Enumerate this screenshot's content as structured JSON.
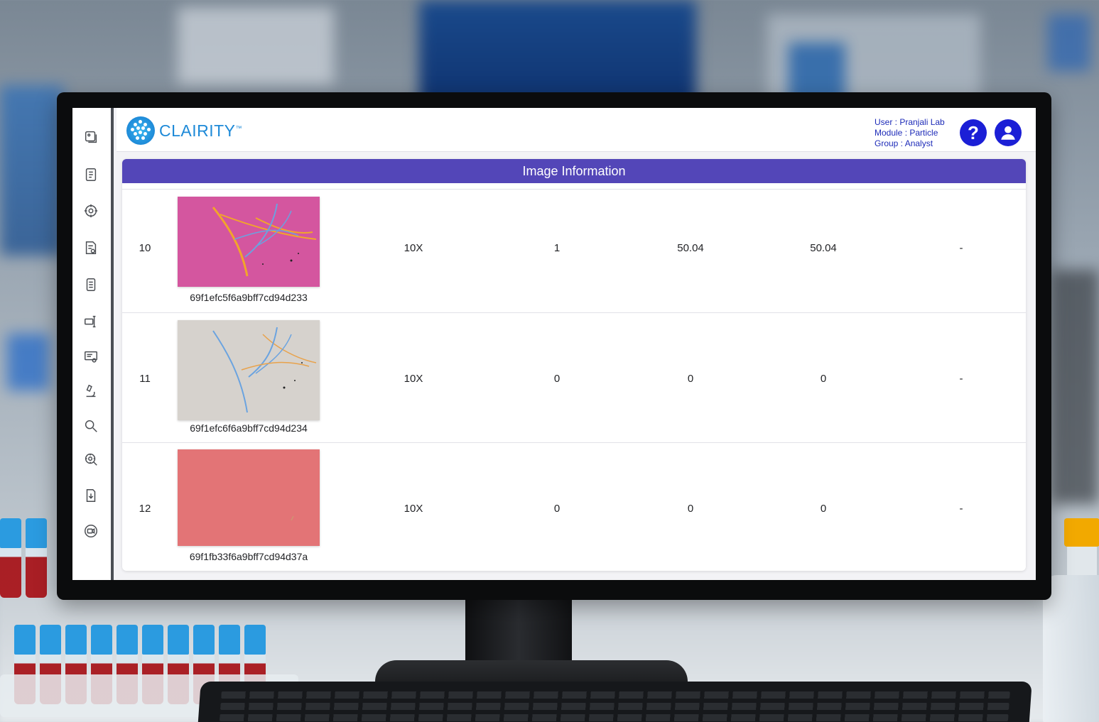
{
  "app": {
    "brand": "CLAIRITY",
    "trademark": "™"
  },
  "user_info": {
    "user": "User : Pranjali Lab",
    "module": "Module : Particle",
    "group": "Group : Analyst"
  },
  "header_buttons": {
    "help_label": "?",
    "help_icon": "question-mark-icon",
    "account_icon": "user-account-icon"
  },
  "sidebar": {
    "items": [
      "image-gallery-icon",
      "book-icon",
      "target-icon",
      "document-search-icon",
      "report-icon",
      "device-icon",
      "certificate-icon",
      "microscope-icon",
      "search-icon",
      "settings-search-icon",
      "download-icon",
      "video-icon"
    ]
  },
  "table": {
    "title": "Image Information",
    "rows": [
      {
        "index": "10",
        "image_id": "69f1efc5f6a9bff7cd94d233",
        "magnification": "10X",
        "count": "1",
        "value_a": "50.04",
        "value_b": "50.04",
        "value_c": "-",
        "thumb_color": "#d4569f"
      },
      {
        "index": "11",
        "image_id": "69f1efc6f6a9bff7cd94d234",
        "magnification": "10X",
        "count": "0",
        "value_a": "0",
        "value_b": "0",
        "value_c": "-",
        "thumb_color": "#d6d2cd"
      },
      {
        "index": "12",
        "image_id": "69f1fb33f6a9bff7cd94d37a",
        "magnification": "10X",
        "count": "0",
        "value_a": "0",
        "value_b": "0",
        "value_c": "-",
        "thumb_color": "#e37476"
      }
    ]
  },
  "colors": {
    "accent": "#5346b8",
    "brand": "#1e8ad8",
    "button": "#1b1fd6"
  }
}
